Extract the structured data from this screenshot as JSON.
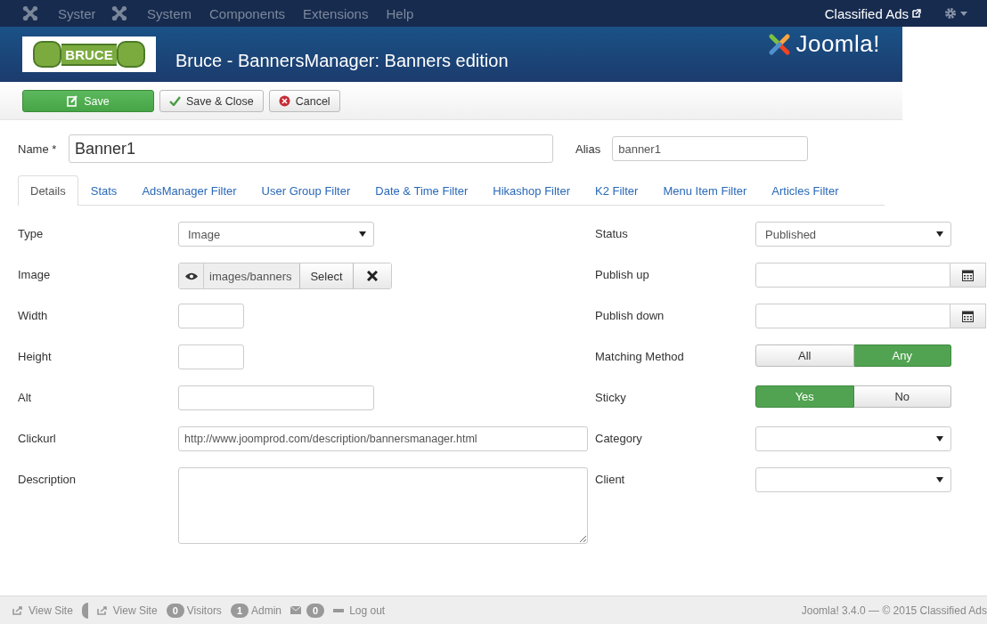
{
  "top_menu": {
    "items": [
      {
        "kind": "logo",
        "label": "Syster"
      },
      {
        "kind": "logo",
        "label": "System"
      },
      {
        "kind": "menu",
        "label": "Components"
      },
      {
        "kind": "menu",
        "label": "Extensions"
      },
      {
        "kind": "menu",
        "label": "Help"
      }
    ],
    "site_link": "Classified Ads"
  },
  "header": {
    "logo_text": "BRUCE",
    "title": "Bruce - BannersManager: Banners edition",
    "brand": "Joomla!"
  },
  "toolbar": [
    {
      "kind": "primary",
      "label": "Save"
    },
    {
      "kind": "check",
      "label": "Save & Close"
    },
    {
      "kind": "cancel",
      "label": "Cancel"
    }
  ],
  "name_field": {
    "label": "Name *",
    "value": "Banner1"
  },
  "alias_field": {
    "label": "Alias",
    "value": "banner1"
  },
  "tabs": [
    {
      "label": "Details",
      "selected": true
    },
    {
      "label": "Stats",
      "selected": false
    },
    {
      "label": "AdsManager Filter",
      "selected": false
    },
    {
      "label": "User Group Filter",
      "selected": false
    },
    {
      "label": "Date & Time Filter",
      "selected": false
    },
    {
      "label": "Hikashop Filter",
      "selected": false
    },
    {
      "label": "K2 Filter",
      "selected": false
    },
    {
      "label": "Menu Item Filter",
      "selected": false
    },
    {
      "label": "Articles Filter",
      "selected": false
    }
  ],
  "left_fields": [
    {
      "kind": "select",
      "label": "Type",
      "value": "Image"
    },
    {
      "kind": "media",
      "label": "Image",
      "value": "images/banners",
      "button": "Select"
    },
    {
      "kind": "small",
      "label": "Width"
    },
    {
      "kind": "small",
      "label": "Height"
    },
    {
      "kind": "text",
      "label": "Alt"
    },
    {
      "kind": "text",
      "label": "Clickurl",
      "value": "http://www.joomprod.com/description/bannersmanager.html"
    },
    {
      "kind": "textarea",
      "label": "Description"
    }
  ],
  "right_fields": [
    {
      "kind": "select",
      "label": "Status",
      "value": "Published"
    },
    {
      "kind": "date",
      "label": "Publish up"
    },
    {
      "kind": "date",
      "label": "Publish down"
    },
    {
      "kind": "toggle",
      "label": "Matching Method",
      "options": [
        {
          "label": "All",
          "selected": false
        },
        {
          "label": "Any",
          "selected": true
        }
      ]
    },
    {
      "kind": "toggle",
      "label": "Sticky",
      "options": [
        {
          "label": "Yes",
          "selected": true
        },
        {
          "label": "No",
          "selected": false
        }
      ]
    },
    {
      "kind": "select",
      "label": "Category"
    },
    {
      "kind": "select",
      "label": "Client"
    }
  ],
  "status_bar": {
    "items": [
      {
        "kind": "link",
        "label": "View Site"
      },
      {
        "kind": "stub"
      },
      {
        "kind": "link",
        "label": "View Site"
      },
      {
        "kind": "count",
        "count": "0",
        "label": "Visitors"
      },
      {
        "kind": "count",
        "count": "1",
        "label": "Admin"
      },
      {
        "kind": "mail",
        "count": "0"
      },
      {
        "kind": "logout",
        "label": "Log out"
      }
    ],
    "copyright": "Joomla! 3.4.0 — © 2015 Classified Ads"
  }
}
